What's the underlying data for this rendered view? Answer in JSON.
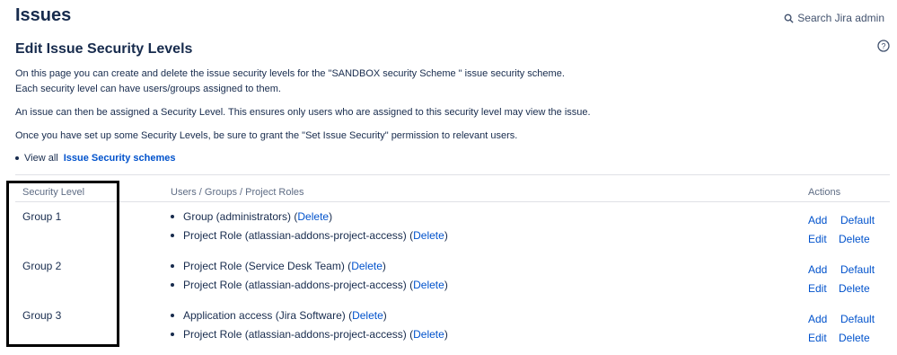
{
  "header": {
    "title": "Issues",
    "search_label": "Search Jira admin"
  },
  "section": {
    "title": "Edit Issue Security Levels"
  },
  "intro": {
    "line1": "On this page you can create and delete the issue security levels for the \"SANDBOX security Scheme \" issue security scheme.",
    "line2": "Each security level can have users/groups assigned to them.",
    "line3": "An issue can then be assigned a Security Level. This ensures only users who are assigned to this security level may view the issue.",
    "line4": "Once you have set up some Security Levels, be sure to grant the \"Set Issue Security\" permission to relevant users."
  },
  "view_all": {
    "prefix": "View all",
    "link": "Issue Security schemes"
  },
  "table": {
    "headers": [
      "Security Level",
      "Users / Groups / Project Roles",
      "Actions"
    ],
    "rows": [
      {
        "level": "Group 1",
        "members": [
          {
            "text": "Group (administrators)",
            "delete": "Delete"
          },
          {
            "text": "Project Role (atlassian-addons-project-access)",
            "delete": "Delete"
          }
        ],
        "actions": [
          "Add",
          "Default",
          "Edit",
          "Delete"
        ]
      },
      {
        "level": "Group 2",
        "members": [
          {
            "text": "Project Role (Service Desk Team)",
            "delete": "Delete"
          },
          {
            "text": "Project Role (atlassian-addons-project-access)",
            "delete": "Delete"
          }
        ],
        "actions": [
          "Add",
          "Default",
          "Edit",
          "Delete"
        ]
      },
      {
        "level": "Group 3",
        "members": [
          {
            "text": "Application access (Jira Software)",
            "delete": "Delete"
          },
          {
            "text": "Project Role (atlassian-addons-project-access)",
            "delete": "Delete"
          }
        ],
        "actions": [
          "Add",
          "Default",
          "Edit",
          "Delete"
        ]
      }
    ]
  },
  "colors": {
    "link": "#0052cc",
    "text": "#172b4d",
    "muted": "#5e6c84",
    "highlight_border": "#000000"
  }
}
